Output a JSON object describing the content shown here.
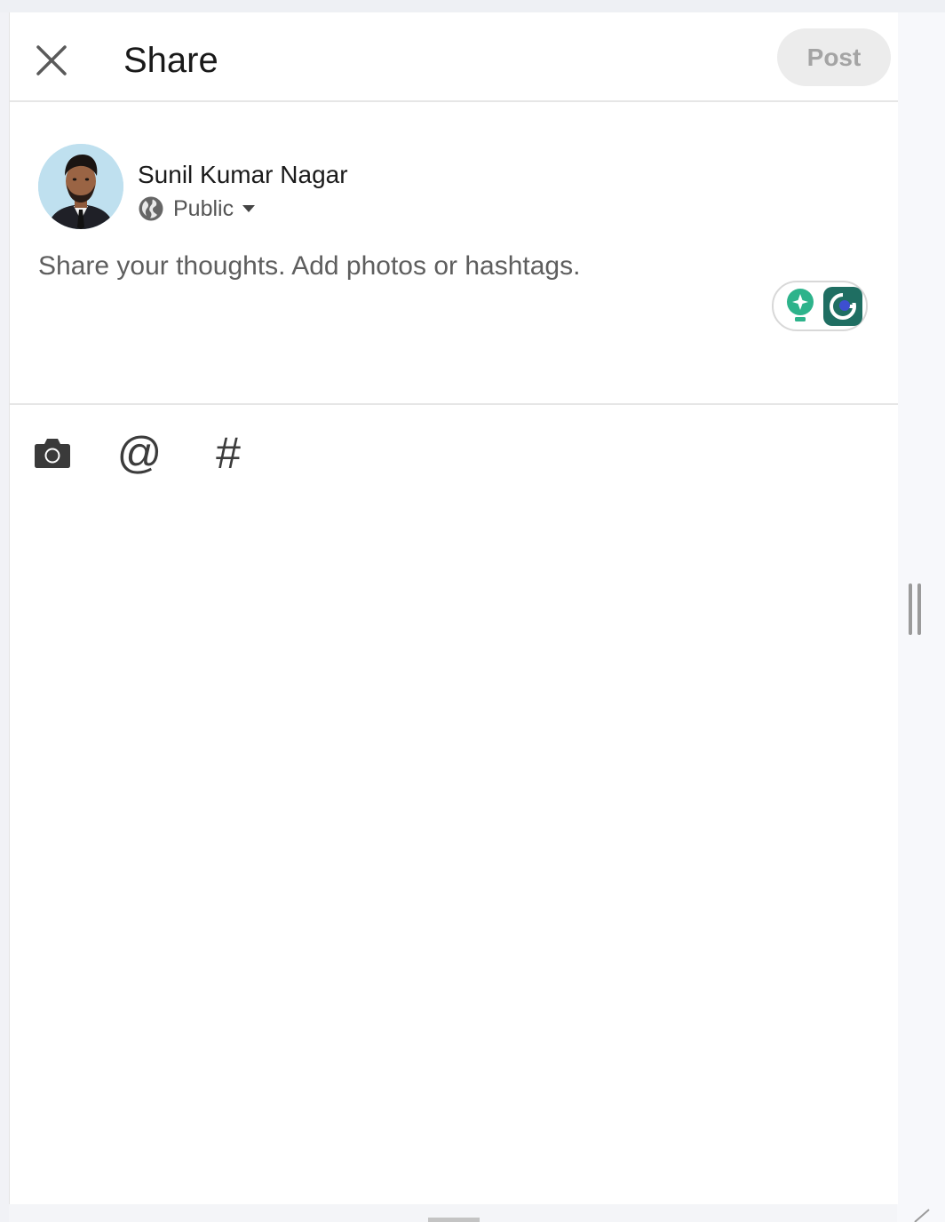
{
  "header": {
    "title": "Share",
    "post_label": "Post"
  },
  "author": {
    "name": "Sunil Kumar Nagar",
    "visibility": "Public"
  },
  "composer": {
    "placeholder": "Share your thoughts. Add photos or hashtags."
  },
  "toolbar": {
    "mention_glyph": "@",
    "hashtag_glyph": "#",
    "icons": [
      "camera-icon",
      "mention-icon",
      "hashtag-icon"
    ]
  },
  "colors": {
    "post_bg_disabled": "#ececec",
    "post_text_disabled": "#a4a4a4",
    "grammarly_green": "#15c39a",
    "grammarly_dark": "#1f6e62"
  }
}
